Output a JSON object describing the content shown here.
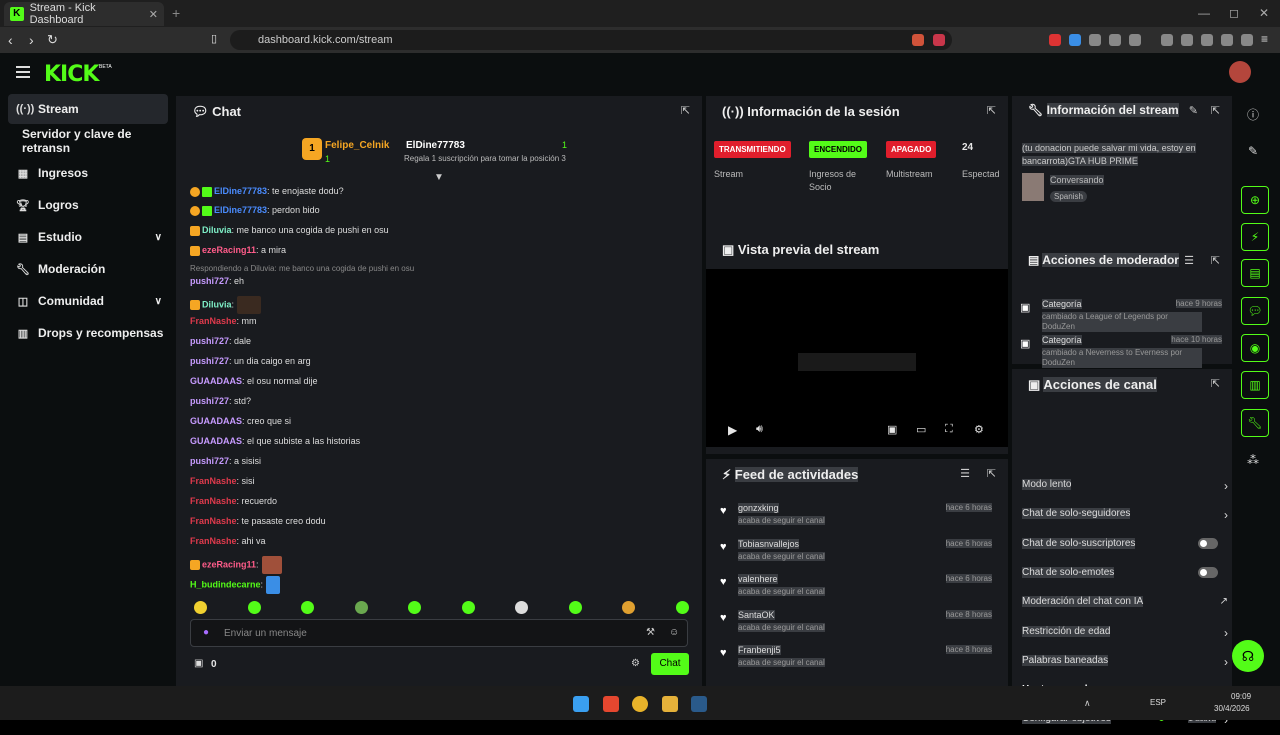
{
  "browser": {
    "tab_title": "Stream - Kick Dashboard",
    "url": "dashboard.kick.com/stream"
  },
  "app": {
    "logo": "KICK",
    "beta": "BETA"
  },
  "sidebar": {
    "items": [
      {
        "label": "Stream",
        "icon": "stream-icon"
      },
      {
        "label": "Servidor y clave de retransn",
        "icon": ""
      },
      {
        "label": "Ingresos",
        "icon": "money-icon"
      },
      {
        "label": "Logros",
        "icon": "trophy-icon"
      },
      {
        "label": "Estudio",
        "icon": "studio-icon"
      },
      {
        "label": "Moderación",
        "icon": "wrench-icon"
      },
      {
        "label": "Comunidad",
        "icon": "community-icon"
      },
      {
        "label": "Drops y recompensas",
        "icon": "drops-icon"
      }
    ]
  },
  "chat": {
    "title": "Chat",
    "pinned": {
      "first_name": "Felipe_Celnik",
      "first_count": "1",
      "second_name": "ElDine77783",
      "second_count": "1",
      "gift_text": "Regala 1 suscripción para tomar la posición 3"
    },
    "messages": [
      {
        "user": "ElDine77783",
        "text": ": te enojaste dodu?",
        "color": "#4a8cff"
      },
      {
        "user": "ElDine77783",
        "text": ": perdon bido",
        "color": "#4a8cff"
      },
      {
        "user": "Diluvia",
        "text": ": me banco una cogida de pushi en osu",
        "color": "#7ff0c8"
      },
      {
        "user": "ezeRacing11",
        "text": ": a mira",
        "color": "#ff5c8a"
      },
      {
        "reply": "Respondiendo a Diluvia: me banco una cogida de pushi en osu"
      },
      {
        "user": "pushi727",
        "text": ": eh",
        "color": "#c79bff"
      },
      {
        "user": "Diluvia",
        "text": ":",
        "color": "#7ff0c8"
      },
      {
        "user": "FranNashe",
        "text": ": mm",
        "color": "#e03a4c"
      },
      {
        "user": "pushi727",
        "text": ": dale",
        "color": "#c79bff"
      },
      {
        "user": "pushi727",
        "text": ": un dia caigo en arg",
        "color": "#c79bff"
      },
      {
        "user": "GUAADAAS",
        "text": ": el osu normal dije",
        "color": "#c79bff"
      },
      {
        "user": "pushi727",
        "text": ": std?",
        "color": "#c79bff"
      },
      {
        "user": "GUAADAAS",
        "text": ": creo que si",
        "color": "#c79bff"
      },
      {
        "user": "GUAADAAS",
        "text": ": el que subiste a las historias",
        "color": "#c79bff"
      },
      {
        "user": "pushi727",
        "text": ": a sisisi",
        "color": "#c79bff"
      },
      {
        "user": "FranNashe",
        "text": ": sisi",
        "color": "#e03a4c"
      },
      {
        "user": "FranNashe",
        "text": ": recuerdo",
        "color": "#e03a4c"
      },
      {
        "user": "FranNashe",
        "text": ": te pasaste creo dodu",
        "color": "#e03a4c"
      },
      {
        "user": "FranNashe",
        "text": ": ahi va",
        "color": "#e03a4c"
      },
      {
        "user": "ezeRacing11",
        "text": ":",
        "color": "#ff5c8a"
      },
      {
        "user": "H_budindecarne",
        "text": ":",
        "color": "#53fc18"
      }
    ],
    "input_placeholder": "Enviar un mensaje",
    "points": "0",
    "send_label": "Chat"
  },
  "session": {
    "title": "Información de la sesión",
    "cols": [
      {
        "status": "TRANSMITIENDO",
        "label": "Stream",
        "color": "#e01e2c"
      },
      {
        "status": "ENCENDIDO",
        "label": "Ingresos de Socio",
        "color": "#53fc18"
      },
      {
        "status": "APAGADO",
        "label": "Multistream",
        "color": "#e01e2c"
      },
      {
        "status": "24",
        "label": "Espectad",
        "color": ""
      }
    ]
  },
  "preview": {
    "title": "Vista previa del stream"
  },
  "feed": {
    "title": "Feed de actividades",
    "items": [
      {
        "name": "gonzxking",
        "sub": "acaba de seguir el canal",
        "time": "hace 6 horas"
      },
      {
        "name": "Tobiasnvallejos",
        "sub": "acaba de seguir el canal",
        "time": "hace 6 horas"
      },
      {
        "name": "valenhere",
        "sub": "acaba de seguir el canal",
        "time": "hace 6 horas"
      },
      {
        "name": "SantaOK",
        "sub": "acaba de seguir el canal",
        "time": "hace 8 horas"
      },
      {
        "name": "Franbenji5",
        "sub": "acaba de seguir el canal",
        "time": "hace 8 horas"
      }
    ]
  },
  "streaminfo": {
    "title": "Información del stream",
    "description": "(tu donacion puede salvar mi vida, estoy en bancarrota)GTA HUB PRIME",
    "category": "Conversando",
    "language": "Spanish"
  },
  "modactions": {
    "title": "Acciones de moderador",
    "items": [
      {
        "name": "Categoría",
        "time": "hace 9 horas",
        "sub": "cambiado a League of Legends por DoduZen"
      },
      {
        "name": "Categoría",
        "time": "hace 10 horas",
        "sub": "cambiado a Neverness to Everness por DoduZen"
      }
    ]
  },
  "channel": {
    "title": "Acciones de canal",
    "rows": [
      {
        "label": "Modo lento",
        "type": "arrow"
      },
      {
        "label": "Chat de solo-seguidores",
        "type": "arrow"
      },
      {
        "label": "Chat de solo-suscriptores",
        "type": "toggle"
      },
      {
        "label": "Chat de solo-emotes",
        "type": "toggle"
      },
      {
        "label": "Moderación del chat con IA",
        "type": "link"
      },
      {
        "label": "Restricción de edad",
        "type": "arrow"
      },
      {
        "label": "Palabras baneadas",
        "type": "arrow"
      },
      {
        "label": "Hostear canal",
        "type": "none"
      },
      {
        "label": "Configurar objetivos",
        "type": "arrow"
      }
    ],
    "goals_status": "1 activa"
  },
  "taskbar": {
    "lang": "ESP",
    "time": "09:09",
    "date": "30/4/2026"
  }
}
